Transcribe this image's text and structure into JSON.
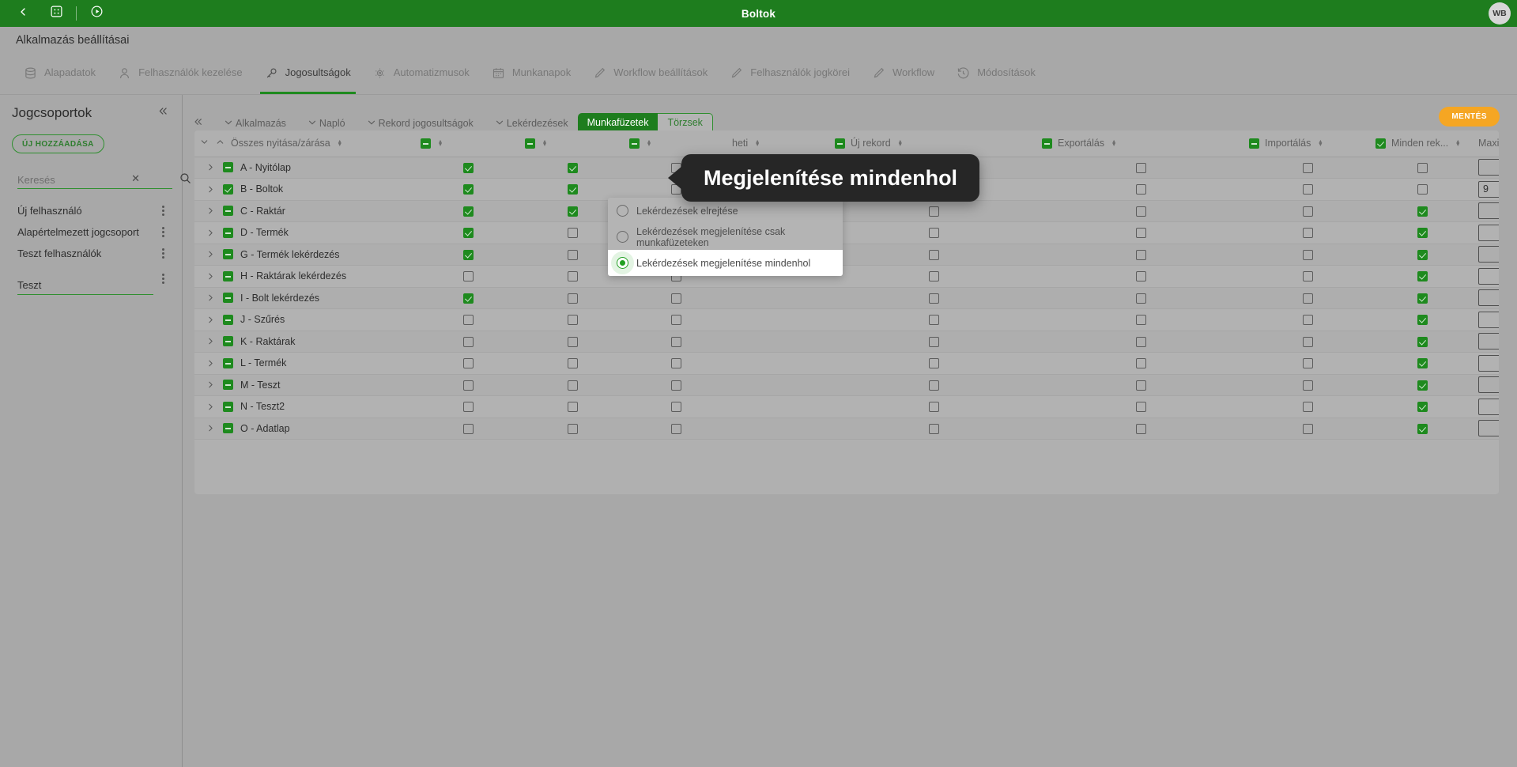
{
  "topbar": {
    "title": "Boltok",
    "back_icon": "chevron-left-icon",
    "apps_icon": "grid-apps-icon",
    "play_icon": "play-circle-icon",
    "avatar_initials": "WB"
  },
  "page": {
    "title": "Alkalmazás beállításai"
  },
  "main_tabs": [
    {
      "label": "Alapadatok",
      "icon": "database-icon",
      "active": false
    },
    {
      "label": "Felhasználók kezelése",
      "icon": "user-icon",
      "active": false
    },
    {
      "label": "Jogosultságok",
      "icon": "key-icon",
      "active": true
    },
    {
      "label": "Automatizmusok",
      "icon": "gear-sync-icon",
      "active": false
    },
    {
      "label": "Munkanapok",
      "icon": "calendar-icon",
      "active": false
    },
    {
      "label": "Workflow beállítások",
      "icon": "pencil-icon",
      "active": false
    },
    {
      "label": "Felhasználók jogkörei",
      "icon": "pencil-icon",
      "active": false
    },
    {
      "label": "Workflow",
      "icon": "pencil-icon",
      "active": false
    },
    {
      "label": "Módosítások",
      "icon": "history-icon",
      "active": false
    }
  ],
  "sidebar": {
    "heading": "Jogcsoportok",
    "collapse_icon": "double-chevron-left-icon",
    "add_button": "ÚJ HOZZÁADÁSA",
    "search": {
      "value": "",
      "placeholder": "Keresés",
      "clear_icon": "close-icon",
      "search_icon": "search-icon"
    },
    "items": [
      {
        "label": "Új felhasználó"
      },
      {
        "label": "Alapértelmezett jogcsoport"
      },
      {
        "label": "Teszt felhasználók"
      }
    ],
    "edit_row": {
      "value": "Teszt"
    }
  },
  "subbar": {
    "collapse_icon": "double-chevron-left-icon",
    "items": [
      {
        "label": "Alkalmazás",
        "icon": "chevron-down-icon"
      },
      {
        "label": "Napló",
        "icon": "chevron-down-icon"
      },
      {
        "label": "Rekord jogosultságok",
        "icon": "chevron-down-icon"
      },
      {
        "label": "Lekérdezések",
        "icon": "chevron-down-icon"
      }
    ],
    "pills": [
      {
        "label": "Munkafüzetek",
        "active": true
      },
      {
        "label": "Törzsek",
        "active": false
      }
    ],
    "save_label": "MENTÉS"
  },
  "dropdown": {
    "options": [
      {
        "label": "Lekérdezések elrejtése",
        "selected": false
      },
      {
        "label": "Lekérdezések megjelenítése csak munkafüzeteken",
        "selected": false
      },
      {
        "label": "Lekérdezések megjelenítése mindenhol",
        "selected": true
      }
    ]
  },
  "tooltip": {
    "text": "Megjelenítése mindenhol"
  },
  "table": {
    "columns": [
      {
        "label": "Összes nyitása/zárása",
        "state": "none",
        "sortable": true
      },
      {
        "label": "",
        "state": "indeterminate",
        "sortable": true
      },
      {
        "label": "",
        "state": "indeterminate",
        "sortable": true
      },
      {
        "label": "",
        "state": "indeterminate",
        "sortable": true
      },
      {
        "label": "heti",
        "state": "none",
        "sortable": true
      },
      {
        "label": "Új rekord",
        "state": "indeterminate",
        "sortable": true
      },
      {
        "label": "Exportálás",
        "state": "indeterminate",
        "sortable": true
      },
      {
        "label": "Importálás",
        "state": "indeterminate",
        "sortable": true
      },
      {
        "label": "Minden rek...",
        "state": "checked",
        "sortable": true
      },
      {
        "label": "Maximális rekor...",
        "state": "none",
        "sortable": true
      }
    ],
    "rows": [
      {
        "name": "A - Nyitólap",
        "lead": "indeterminate",
        "c": [
          "checked",
          "checked",
          "unchecked",
          "unchecked",
          "unchecked",
          "unchecked",
          "unchecked"
        ],
        "max": ""
      },
      {
        "name": "B - Boltok",
        "lead": "checked",
        "c": [
          "checked",
          "checked",
          "unchecked",
          "unchecked",
          "unchecked",
          "unchecked",
          "unchecked"
        ],
        "max": "9"
      },
      {
        "name": "C - Raktár",
        "lead": "indeterminate",
        "c": [
          "checked",
          "checked",
          "unchecked",
          "unchecked",
          "unchecked",
          "unchecked",
          "checked"
        ],
        "max": ""
      },
      {
        "name": "D - Termék",
        "lead": "indeterminate",
        "c": [
          "checked",
          "unchecked",
          "unchecked",
          "unchecked",
          "unchecked",
          "unchecked",
          "checked"
        ],
        "max": ""
      },
      {
        "name": "G - Termék lekérdezés",
        "lead": "indeterminate",
        "c": [
          "checked",
          "unchecked",
          "unchecked",
          "unchecked",
          "unchecked",
          "unchecked",
          "checked"
        ],
        "max": ""
      },
      {
        "name": "H - Raktárak lekérdezés",
        "lead": "indeterminate",
        "c": [
          "unchecked",
          "unchecked",
          "unchecked",
          "unchecked",
          "unchecked",
          "unchecked",
          "checked"
        ],
        "max": ""
      },
      {
        "name": "I - Bolt lekérdezés",
        "lead": "indeterminate",
        "c": [
          "checked",
          "unchecked",
          "unchecked",
          "unchecked",
          "unchecked",
          "unchecked",
          "checked"
        ],
        "max": ""
      },
      {
        "name": "J - Szűrés",
        "lead": "indeterminate",
        "c": [
          "unchecked",
          "unchecked",
          "unchecked",
          "unchecked",
          "unchecked",
          "unchecked",
          "checked"
        ],
        "max": ""
      },
      {
        "name": "K - Raktárak",
        "lead": "indeterminate",
        "c": [
          "unchecked",
          "unchecked",
          "unchecked",
          "unchecked",
          "unchecked",
          "unchecked",
          "checked"
        ],
        "max": ""
      },
      {
        "name": "L - Termék",
        "lead": "indeterminate",
        "c": [
          "unchecked",
          "unchecked",
          "unchecked",
          "unchecked",
          "unchecked",
          "unchecked",
          "checked"
        ],
        "max": ""
      },
      {
        "name": "M - Teszt",
        "lead": "indeterminate",
        "c": [
          "unchecked",
          "unchecked",
          "unchecked",
          "unchecked",
          "unchecked",
          "unchecked",
          "checked"
        ],
        "max": ""
      },
      {
        "name": "N - Teszt2",
        "lead": "indeterminate",
        "c": [
          "unchecked",
          "unchecked",
          "unchecked",
          "unchecked",
          "unchecked",
          "unchecked",
          "checked"
        ],
        "max": ""
      },
      {
        "name": "O - Adatlap",
        "lead": "indeterminate",
        "c": [
          "unchecked",
          "unchecked",
          "unchecked",
          "unchecked",
          "unchecked",
          "unchecked",
          "checked"
        ],
        "max": ""
      }
    ]
  },
  "colors": {
    "brand_green": "#1e7d1e",
    "accent_green": "#1e8a1e",
    "save_orange": "#f5a623",
    "page_bg": "#a8a8a8",
    "tooltip_bg": "#262626"
  }
}
